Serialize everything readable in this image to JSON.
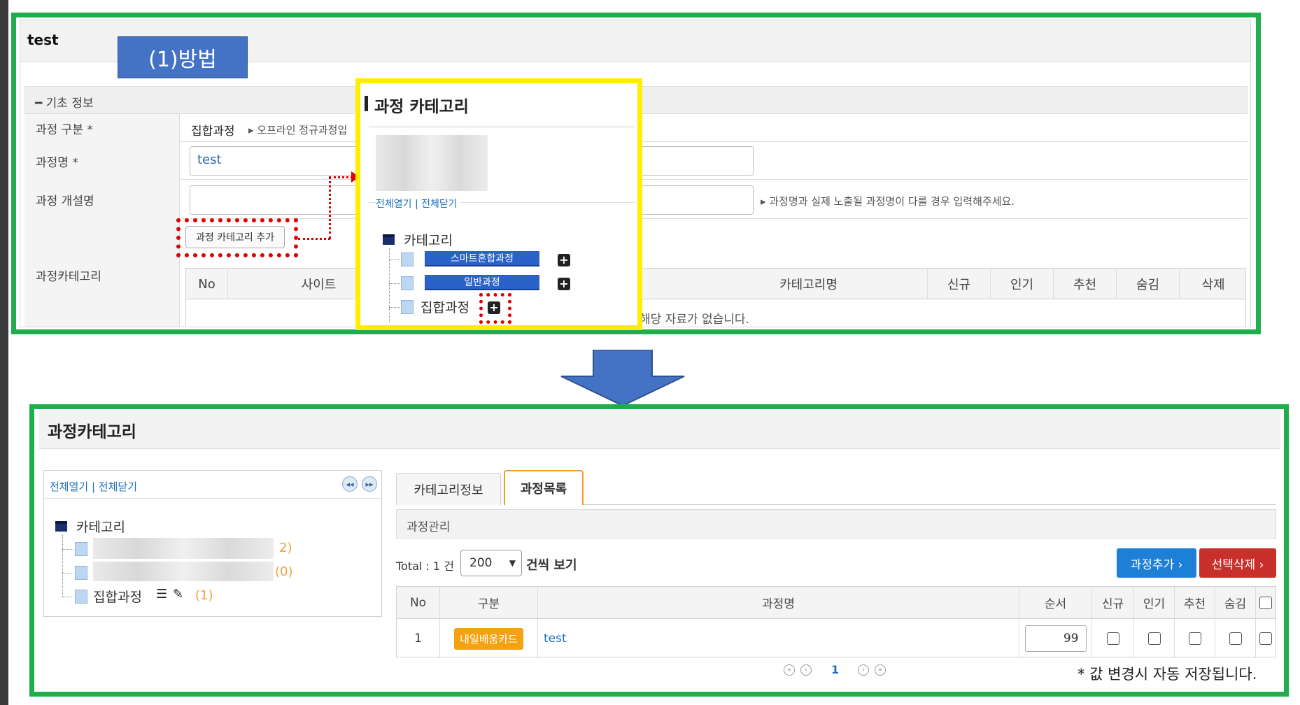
{
  "top": {
    "title": "test",
    "method_label": "(1)방법",
    "section": "━ 기초 정보",
    "rows": {
      "type_label": "과정 구분 *",
      "type_value": "집합과정",
      "type_note": "▸ 오프라인 정규과정입",
      "name_label": "과정명 *",
      "name_value": "test",
      "open_label": "과정 개설명",
      "open_note": "▸ 과정명과 실제 노출될 과정명이 다를 경우 입력해주세요.",
      "category_label": "과정카테고리",
      "add_button": "과정 카테고리 추가"
    },
    "table_headers": [
      "No",
      "사이트",
      "카테고리명",
      "신규",
      "인기",
      "추천",
      "숨김",
      "삭제"
    ],
    "empty_message": "해당 자료가 없습니다."
  },
  "popup": {
    "title": "과정 카테고리",
    "expand_links": "전체열기 | 전체닫기",
    "root": "카테고리",
    "items": [
      "스마트혼합과정",
      "일반과정",
      "집합과정"
    ]
  },
  "bottom": {
    "title": "과정카테고리",
    "expand_links": "전체열기 | 전체닫기",
    "tree_root": "카테고리",
    "tree_items": [
      {
        "label": "",
        "count": "2)"
      },
      {
        "label": "",
        "count": "(0)"
      },
      {
        "label": "집합과정",
        "count": "(1)"
      }
    ],
    "tabs": [
      "카테고리정보",
      "과정목록"
    ],
    "sub_title": "과정관리",
    "total": "Total : 1 건",
    "page_size": "200",
    "page_size_suffix": "건씩 보기",
    "add_button": "과정추가 ›",
    "delete_button": "선택삭제 ›",
    "columns": [
      "No",
      "구분",
      "과정명",
      "순서",
      "신규",
      "인기",
      "추천",
      "숨김"
    ],
    "row": {
      "no": "1",
      "type": "내일배움카드",
      "name": "test",
      "order": "99"
    },
    "page_current": "1",
    "save_note": "* 값 변경시 자동 저장됩니다."
  }
}
